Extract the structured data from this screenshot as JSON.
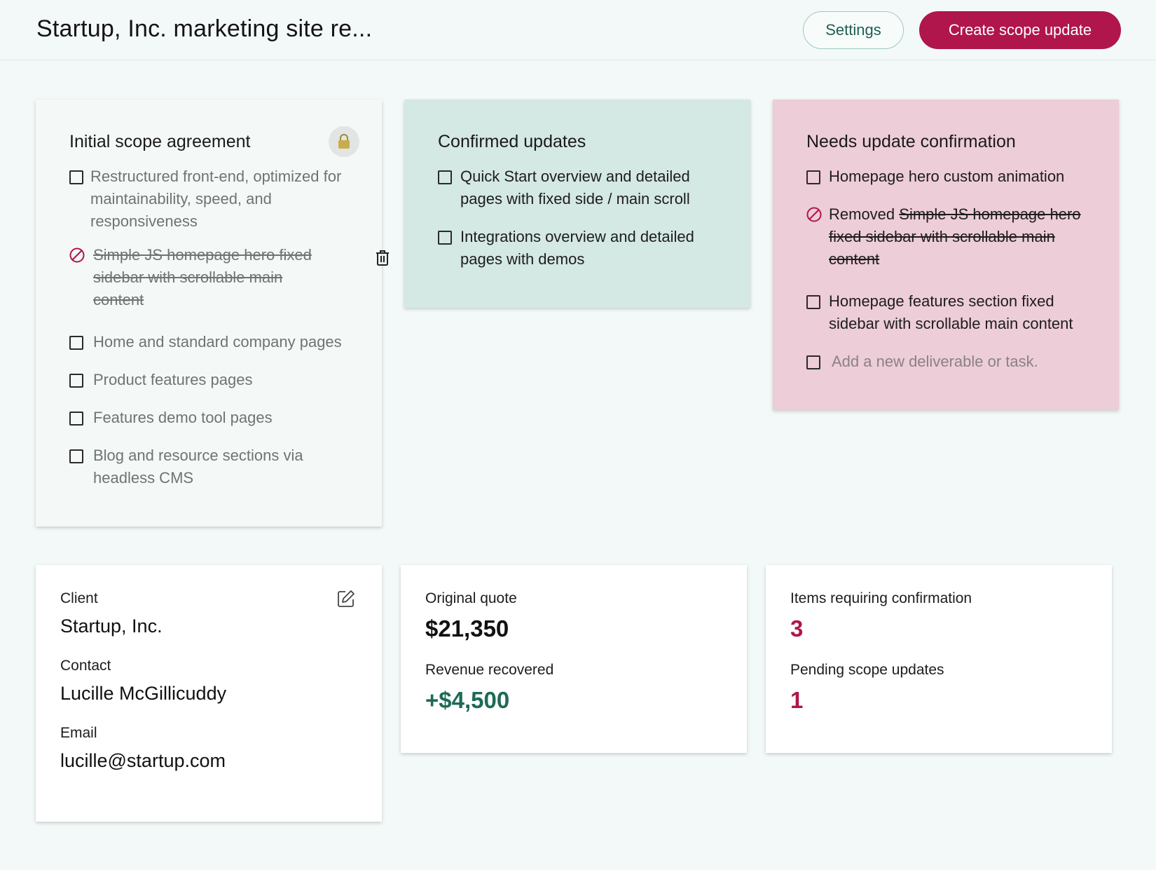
{
  "header": {
    "title": "Startup, Inc. marketing site re...",
    "settings_label": "Settings",
    "create_label": "Create scope update"
  },
  "colors": {
    "brand": "#b0154c",
    "confirmed_bg": "#d4e8e4",
    "needs_bg": "#edcdd7",
    "positive": "#1d6b57"
  },
  "columns": {
    "initial": {
      "title": "Initial scope agreement",
      "lock_icon": "lock-icon",
      "items": [
        {
          "text": "Restructured front-end, optimized for maintainability, speed, and responsiveness"
        },
        {
          "text": "Simple JS homepage hero fixed sidebar with scrollable main content",
          "removed": true
        },
        {
          "text": "Home and standard company pages"
        },
        {
          "text": "Product features pages"
        },
        {
          "text": "Features demo tool pages"
        },
        {
          "text": "Blog and resource sections via headless CMS"
        }
      ]
    },
    "confirmed": {
      "title": "Confirmed updates",
      "items": [
        {
          "text": "Quick Start overview and detailed pages with fixed side / main scroll"
        },
        {
          "text": "Integrations overview and detailed pages with demos"
        }
      ]
    },
    "needs": {
      "title": "Needs update confirmation",
      "items": [
        {
          "text": "Homepage hero custom animation"
        },
        {
          "prefix": "Removed",
          "text": "Simple JS homepage hero fixed sidebar with scrollable main content",
          "removed": true
        },
        {
          "text": "Homepage features section fixed sidebar with scrollable main content"
        }
      ],
      "add_placeholder": "Add a new deliverable or task."
    }
  },
  "client_card": {
    "client_label": "Client",
    "client_value": "Startup, Inc.",
    "contact_label": "Contact",
    "contact_value": "Lucille McGillicuddy",
    "email_label": "Email",
    "email_value": "lucille@startup.com"
  },
  "quote_card": {
    "original_label": "Original quote",
    "original_value": "$21,350",
    "recovered_label": "Revenue recovered",
    "recovered_value": "+$4,500"
  },
  "items_card": {
    "confirm_label": "Items requiring confirmation",
    "confirm_value": "3",
    "pending_label": "Pending scope updates",
    "pending_value": "1"
  }
}
